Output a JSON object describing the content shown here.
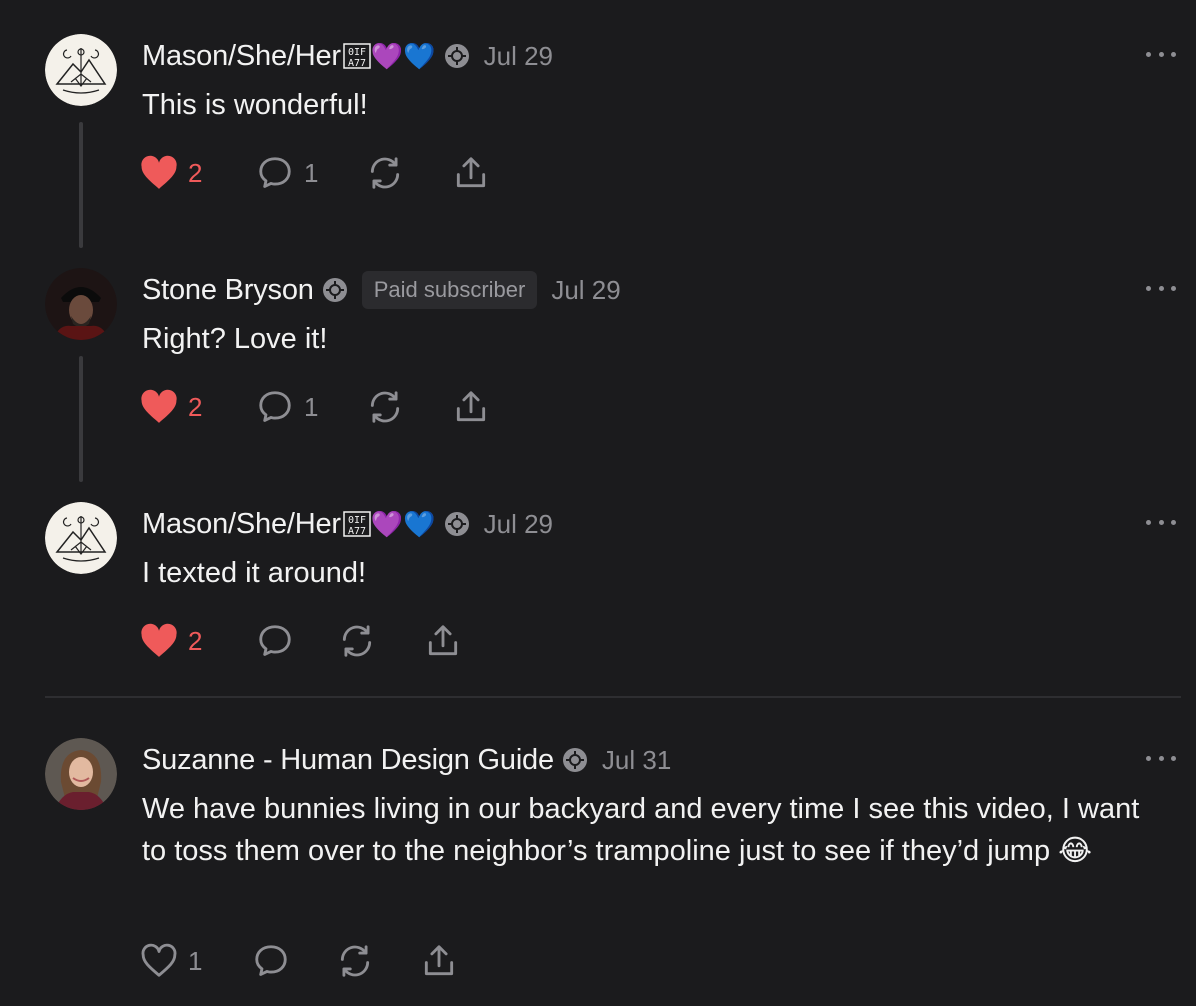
{
  "comments": [
    {
      "author": "Mason/She/Her",
      "author_suffix_emoji": "💜💙",
      "date": "Jul 29",
      "text": "This is wonderful!",
      "likes": "2",
      "replies": "1"
    },
    {
      "author": "Stone Bryson",
      "badge": "Paid subscriber",
      "date": "Jul 29",
      "text": "Right? Love it!",
      "likes": "2",
      "replies": "1"
    },
    {
      "author": "Mason/She/Her",
      "author_suffix_emoji": "💜💙",
      "date": "Jul 29",
      "text": "I texted it around!",
      "likes": "2"
    },
    {
      "author": "Suzanne - Human Design Guide",
      "date": "Jul 31",
      "text": "We have bunnies living in our backyard and every time I see this video, I want to toss them over to the neighbor’s trampoline just to see if they’d jump 😂",
      "likes": "1"
    }
  ],
  "colors": {
    "background": "#1b1b1d",
    "like_active": "#ef5a5a",
    "muted": "#8e8e93"
  }
}
